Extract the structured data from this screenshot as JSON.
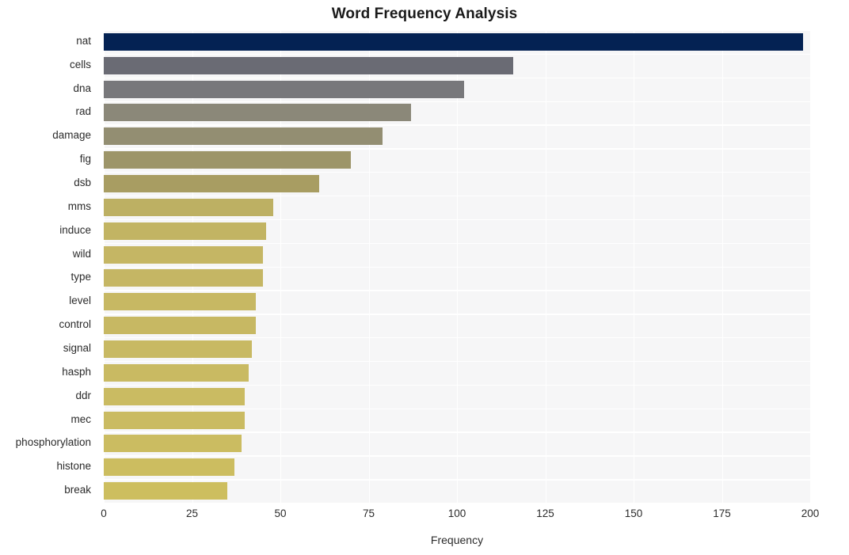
{
  "chart_data": {
    "type": "bar",
    "orientation": "horizontal",
    "title": "Word Frequency Analysis",
    "xlabel": "Frequency",
    "ylabel": "",
    "xlim": [
      0,
      200
    ],
    "xticks": [
      0,
      25,
      50,
      75,
      100,
      125,
      150,
      175,
      200
    ],
    "xtick_labels": [
      "0",
      "25",
      "50",
      "75",
      "100",
      "125",
      "150",
      "175",
      "200"
    ],
    "grid": true,
    "grid_color": "#ffffff",
    "plot_background": "#f6f6f7",
    "figure_background": "#ffffff",
    "legend": null,
    "categories": [
      "nat",
      "cells",
      "dna",
      "rad",
      "damage",
      "fig",
      "dsb",
      "mms",
      "induce",
      "wild",
      "type",
      "level",
      "control",
      "signal",
      "hasph",
      "ddr",
      "mec",
      "phosphorylation",
      "histone",
      "break"
    ],
    "values": [
      198,
      116,
      102,
      87,
      79,
      70,
      61,
      48,
      46,
      45,
      45,
      43,
      43,
      42,
      41,
      40,
      40,
      39,
      37,
      35
    ],
    "bar_colors": [
      "#042253",
      "#6a6b74",
      "#78787b",
      "#8b8879",
      "#938e72",
      "#9d9569",
      "#a89d62",
      "#bdb063",
      "#c2b463",
      "#c5b664",
      "#c5b664",
      "#c7b863",
      "#c7b863",
      "#c8b963",
      "#c9ba62",
      "#cabb62",
      "#cabb62",
      "#cbbc61",
      "#ccbd60",
      "#cdbe5f"
    ]
  }
}
